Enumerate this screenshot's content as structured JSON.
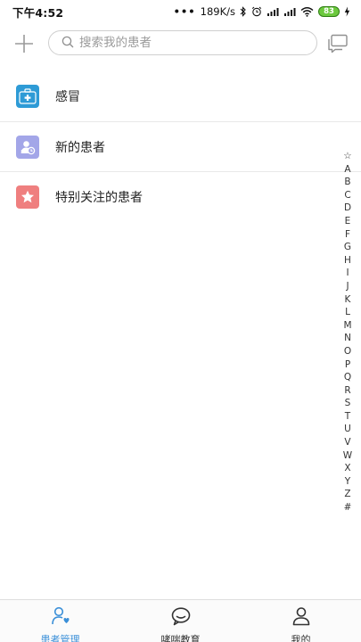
{
  "status_bar": {
    "time": "下午4:52",
    "network_speed": "189K/s",
    "battery_level": "83"
  },
  "header": {
    "search_placeholder": "搜索我的患者",
    "add_icon": "plus-icon",
    "chat_icon": "chat-bubbles-icon"
  },
  "groups": [
    {
      "label": "感冒",
      "icon": "medical-kit-icon",
      "color": "#2e9bd6"
    },
    {
      "label": "新的患者",
      "icon": "new-patient-icon",
      "color": "#a3a6e8"
    },
    {
      "label": "特别关注的患者",
      "icon": "star-icon",
      "color": "#ef7f7f"
    }
  ],
  "alphabet_index": [
    "☆",
    "A",
    "B",
    "C",
    "D",
    "E",
    "F",
    "G",
    "H",
    "I",
    "J",
    "K",
    "L",
    "M",
    "N",
    "O",
    "P",
    "Q",
    "R",
    "S",
    "T",
    "U",
    "V",
    "W",
    "X",
    "Y",
    "Z",
    "#"
  ],
  "bottom_nav": [
    {
      "label": "患者管理",
      "icon": "patient-manage-icon",
      "active": true
    },
    {
      "label": "哮喘教育",
      "icon": "chat-bubble-icon",
      "active": false
    },
    {
      "label": "我的",
      "icon": "person-icon",
      "active": false
    }
  ],
  "colors": {
    "accent": "#3a8fd8",
    "battery": "#6cc93e"
  }
}
